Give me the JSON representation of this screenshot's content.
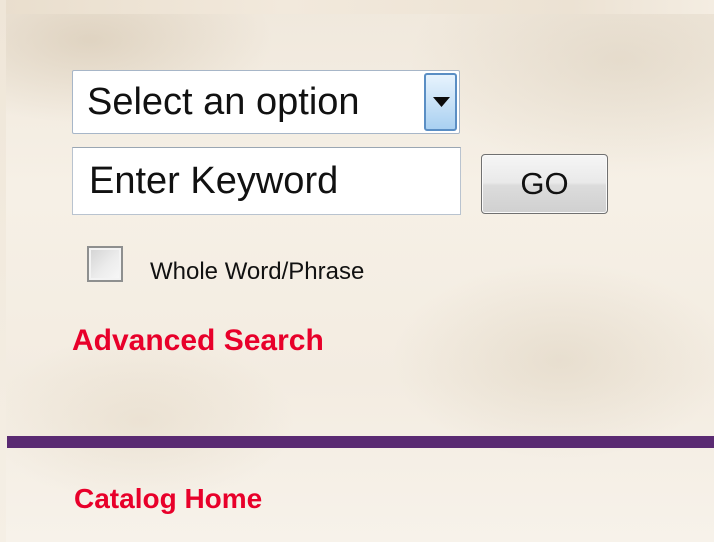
{
  "search": {
    "select_value": "Select an option",
    "keyword_placeholder": "Enter Keyword",
    "go_label": "GO",
    "whole_word_label": "Whole Word/Phrase",
    "whole_word_checked": false
  },
  "links": {
    "advanced_search": "Advanced Search",
    "catalog_home": "Catalog Home"
  },
  "colors": {
    "link": "#e8002a",
    "divider": "#5a2a72",
    "dropdown_button": "#a9d0f1"
  },
  "icons": {
    "dropdown": "triangle-down"
  }
}
